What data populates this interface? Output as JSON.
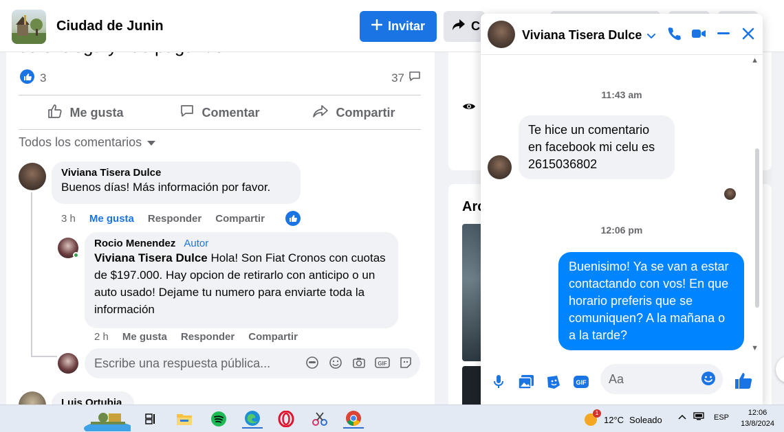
{
  "header": {
    "page_name": "Ciudad de Junin",
    "invite_label": "Invitar",
    "share_label": "C"
  },
  "post": {
    "text_fragment": "se entrega y vas pagando",
    "reaction_count": "3",
    "comment_count": "37",
    "actions": {
      "like": "Me gusta",
      "comment": "Comentar",
      "share": "Compartir"
    },
    "sort_label": "Todos los comentarios"
  },
  "comments": [
    {
      "author": "Viviana Tisera Dulce",
      "text": "Buenos días! Más información por favor.",
      "time": "3 h",
      "like": "Me gusta",
      "reply": "Responder",
      "share": "Compartir"
    }
  ],
  "reply": {
    "author": "Rocio Menendez",
    "author_tag": "Autor",
    "mention": "Viviana Tisera Dulce",
    "text": " Hola! Son Fiat Cronos con cuotas de $197.000. Hay opcion de retirarlo con anticipo o un auto usado! Dejame tu numero para enviarte toda la información",
    "time": "2 h",
    "like": "Me gusta",
    "reply": "Responder",
    "share": "Compartir"
  },
  "reply_input": {
    "placeholder": "Escribe una respuesta pública..."
  },
  "next_comment": {
    "author": "Luis Ortubia"
  },
  "right_column": {
    "card2_title": "Arc"
  },
  "chat": {
    "contact_name": "Viviana Tisera Dulce",
    "messages": [
      {
        "timestamp": "11:43 am",
        "direction": "in",
        "text": "Te hice un comentario en facebook mi celu es 2615036802"
      },
      {
        "timestamp": "12:06 pm",
        "direction": "out",
        "text": "Buenisimo! Ya se van a estar contactando con vos! En que horario preferis que se comuniquen? A la mañana o a la tarde?"
      }
    ],
    "input_placeholder": "Aa"
  },
  "taskbar": {
    "temperature": "12°C",
    "weather": "Soleado",
    "weather_badge": "1",
    "language": "ESP",
    "time": "12:06",
    "date": "13/8/2024"
  },
  "colors": {
    "facebook_blue": "#1b74e4",
    "messenger_blue": "#0084ff",
    "bubble_gray": "#f0f2f5",
    "secondary_text": "#65676b"
  }
}
